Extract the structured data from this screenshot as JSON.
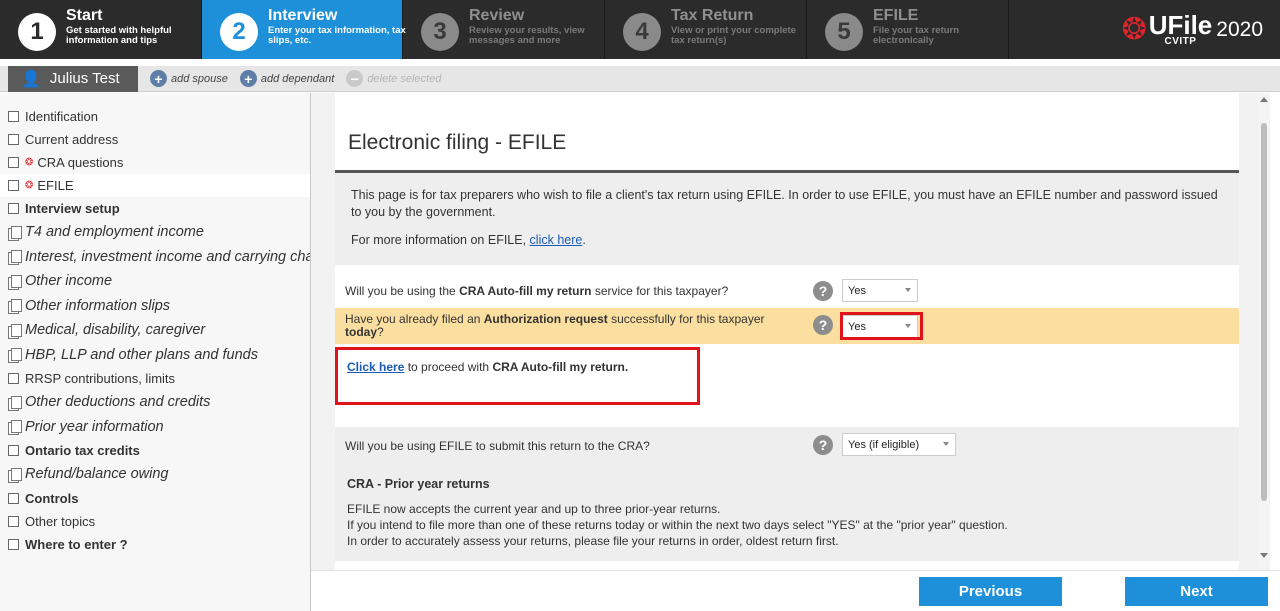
{
  "steps": [
    {
      "num": "1",
      "title": "Start",
      "sub": "Get started with helpful information and tips"
    },
    {
      "num": "2",
      "title": "Interview",
      "sub": "Enter your tax information, tax slips, etc."
    },
    {
      "num": "3",
      "title": "Review",
      "sub": "Review your results, view messages and more"
    },
    {
      "num": "4",
      "title": "Tax Return",
      "sub": "View or print your complete tax return(s)"
    },
    {
      "num": "5",
      "title": "EFILE",
      "sub": "File your tax return electronically"
    }
  ],
  "logo": {
    "name": "UFile",
    "sub": "CVITP",
    "year": "2020"
  },
  "userbar": {
    "user": "Julius Test",
    "add_spouse": "add spouse",
    "add_dependant": "add dependant",
    "delete_selected": "delete selected"
  },
  "sidebar": {
    "items": [
      "Identification",
      "Current address",
      "CRA questions",
      "EFILE",
      "Interview setup",
      "T4 and employment income",
      "Interest, investment income and carrying charges",
      "Other income",
      "Other information slips",
      "Medical, disability, caregiver",
      "HBP, LLP and other plans and funds",
      "RRSP contributions, limits",
      "Other deductions and credits",
      "Prior year information",
      "Ontario tax credits",
      "Refund/balance owing",
      "Controls",
      "Other topics",
      "Where to enter ?"
    ]
  },
  "main": {
    "title": "Electronic filing - EFILE",
    "info": {
      "text": "This page is for tax preparers who wish to file a client's tax return using EFILE. In order to use EFILE, you must have an EFILE number and password issued to you by the government.",
      "more_prefix": "For more information on EFILE, ",
      "more_link": "click here",
      "more_suffix": "."
    },
    "q1": {
      "pre": "Will you be using the ",
      "bold": "CRA Auto-fill my return",
      "post": " service for this taxpayer?",
      "value": "Yes"
    },
    "q2": {
      "pre": "Have you already filed an ",
      "bold": "Authorization request",
      "mid": " successfully for this taxpayer ",
      "bold2": "today",
      "post": "?",
      "value": "Yes"
    },
    "autofill": {
      "link": "Click here",
      "mid": " to proceed with ",
      "bold": "CRA Auto-fill my return."
    },
    "q3": {
      "text": "Will you be using EFILE to submit this return to the CRA?",
      "value": "Yes (if eligible)"
    },
    "prior": {
      "title": "CRA - Prior year returns",
      "line1": "EFILE now accepts the current year and up to three prior-year returns.",
      "line2": "If you intend to file more than one of these returns today or within the next two days select \"YES\" at the \"prior year\" question.",
      "line3": "In order to accurately assess your returns, please file your returns in order, oldest return first."
    },
    "help": "?"
  },
  "bottom": {
    "previous": "Previous",
    "next": "Next"
  }
}
